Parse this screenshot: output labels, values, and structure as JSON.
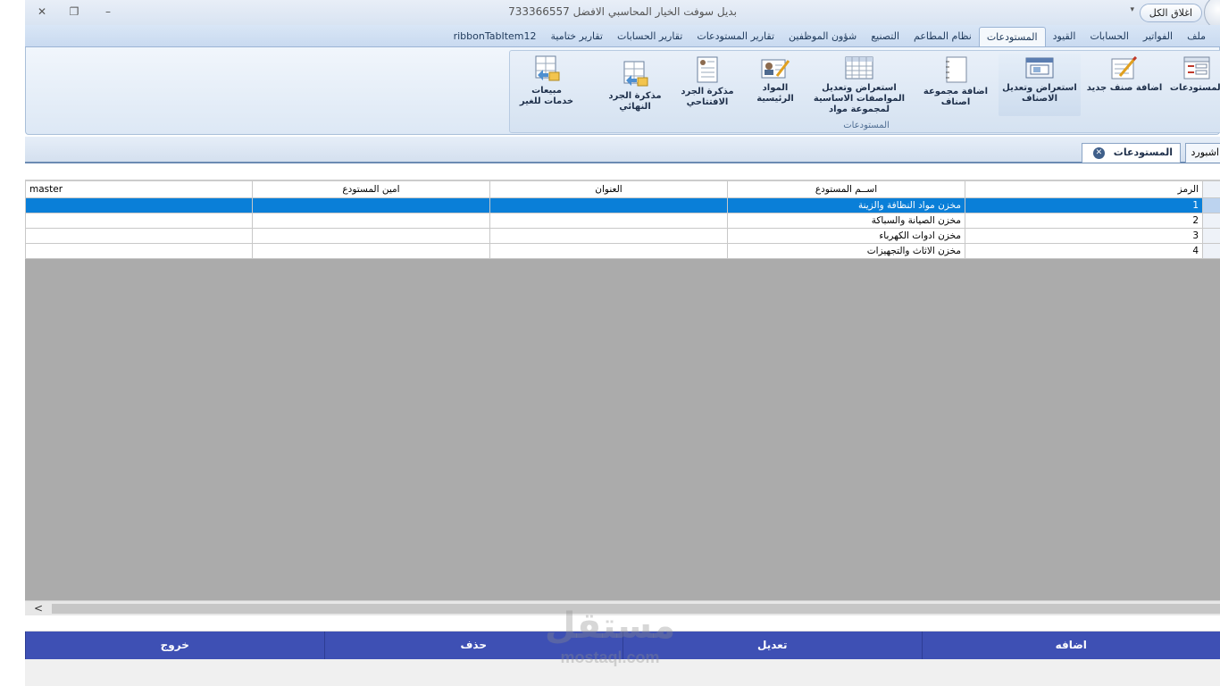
{
  "window": {
    "title": "بديل سوفت الخيار المحاسبي الافضل 733366557",
    "close_all": "اغلاق الكل",
    "minimize_glyph": "–",
    "restore_glyph": "❐",
    "close_glyph": "✕",
    "qa_arrow": "▾"
  },
  "ribbon": {
    "tabs": [
      {
        "label": "ملف"
      },
      {
        "label": "الفواتير"
      },
      {
        "label": "الحسابات"
      },
      {
        "label": "القيود"
      },
      {
        "label": "المستودعات"
      },
      {
        "label": "نظام المطاعم"
      },
      {
        "label": "التصنيع"
      },
      {
        "label": "شؤون الموظفين"
      },
      {
        "label": "تقارير المستودعات"
      },
      {
        "label": "تقارير الحسابات"
      },
      {
        "label": "تقارير ختامية"
      },
      {
        "label": "ribbonTabItem12"
      }
    ],
    "active_tab": "المستودعات",
    "group_label": "المستودعات",
    "buttons": [
      {
        "label": "المستودعات",
        "icon": "warehouse-form-icon"
      },
      {
        "label": "اضافة صنف جديد",
        "icon": "edit-item-icon"
      },
      {
        "label": "استعراض وتعديل الاصناف",
        "icon": "browse-items-icon"
      },
      {
        "label": "اضافة مجموعة اصناف",
        "icon": "notebook-icon"
      },
      {
        "label": "استعراض وتعديل المواصفات الاساسية لمجموعة مواد",
        "icon": "spreadsheet-icon"
      },
      {
        "label": "المواد الرئيسية",
        "icon": "contact-card-icon"
      },
      {
        "label": "مذكرة الجرد الافتتاحي",
        "icon": "inventory-list-icon"
      },
      {
        "label": "مذكرة الجرد النهائي",
        "icon": "final-inventory-icon"
      },
      {
        "label": "مبيعات خدمات للغير",
        "icon": "service-sales-icon"
      }
    ]
  },
  "doc_tabs": [
    {
      "label": "اشبورد"
    },
    {
      "label": "المستودعات",
      "close_glyph": "✕"
    }
  ],
  "grid": {
    "columns": [
      "الرمز",
      "اســم المستودع",
      "العنوان",
      "امين المستودع",
      "master"
    ],
    "rows": [
      {
        "code": "1",
        "name": "مخزن مواد النظافة والزينة",
        "address": "",
        "keeper": "",
        "master": ""
      },
      {
        "code": "2",
        "name": "مخزن الصيانة والسباكة",
        "address": "",
        "keeper": "",
        "master": ""
      },
      {
        "code": "3",
        "name": "مخزن ادوات الكهرباء",
        "address": "",
        "keeper": "",
        "master": ""
      },
      {
        "code": "4",
        "name": "مخزن الاثاث والتجهيزات",
        "address": "",
        "keeper": "",
        "master": ""
      }
    ],
    "selected_row": 1
  },
  "scrollbar": {
    "left_arrow": "<"
  },
  "actions": {
    "add": "اضافه",
    "edit": "تعديل",
    "delete": "حذف",
    "exit": "خروج"
  },
  "watermark": {
    "arabic": "مستقل",
    "latin": "mostaql.com"
  },
  "colors": {
    "action_button": "#3e50b4",
    "selected_row": "#0a7fd8",
    "grid_background": "#ababab",
    "ribbon_text": "#1e395b"
  }
}
